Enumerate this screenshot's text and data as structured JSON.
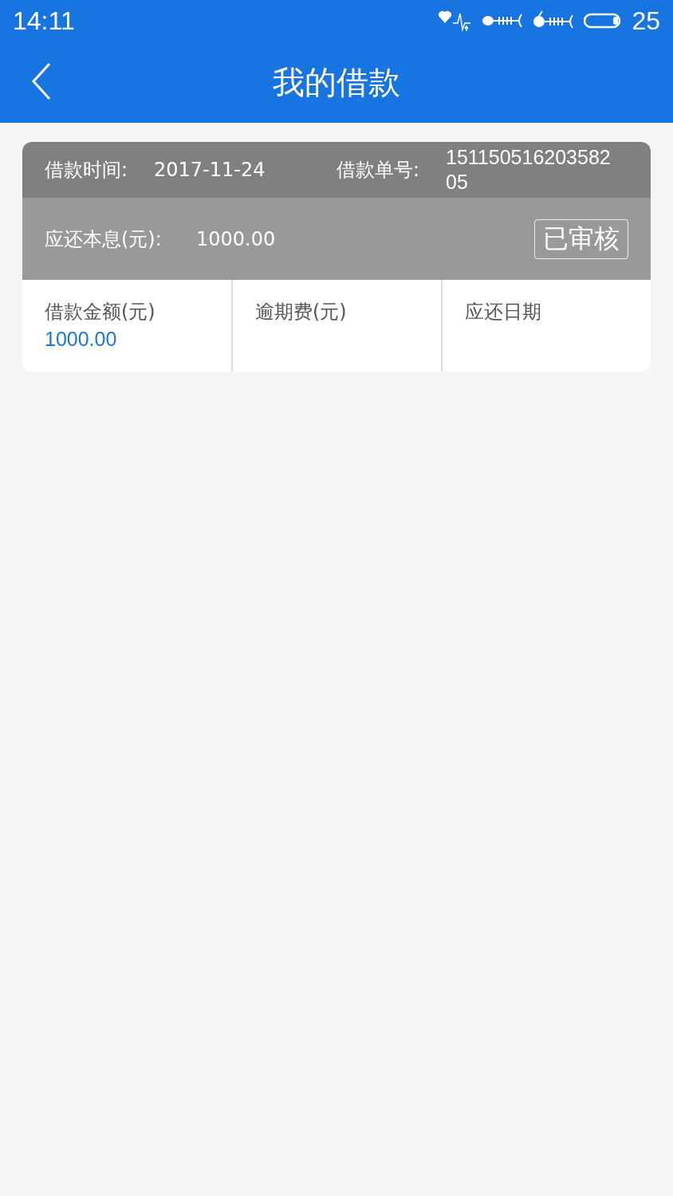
{
  "status_bar": {
    "time": "14:11",
    "battery_text": "25"
  },
  "header": {
    "title": "我的借款"
  },
  "loan": {
    "time_label": "借款时间:",
    "time_value": "2017-11-24",
    "number_label": "借款单号:",
    "number_value": "15115051620358205",
    "due_label": "应还本息(元):",
    "due_value": "1000.00",
    "status": "已审核",
    "cells": [
      {
        "label": "借款金额(元)",
        "value": "1000.00"
      },
      {
        "label": "逾期费(元)"
      },
      {
        "label": "应还日期"
      }
    ]
  }
}
